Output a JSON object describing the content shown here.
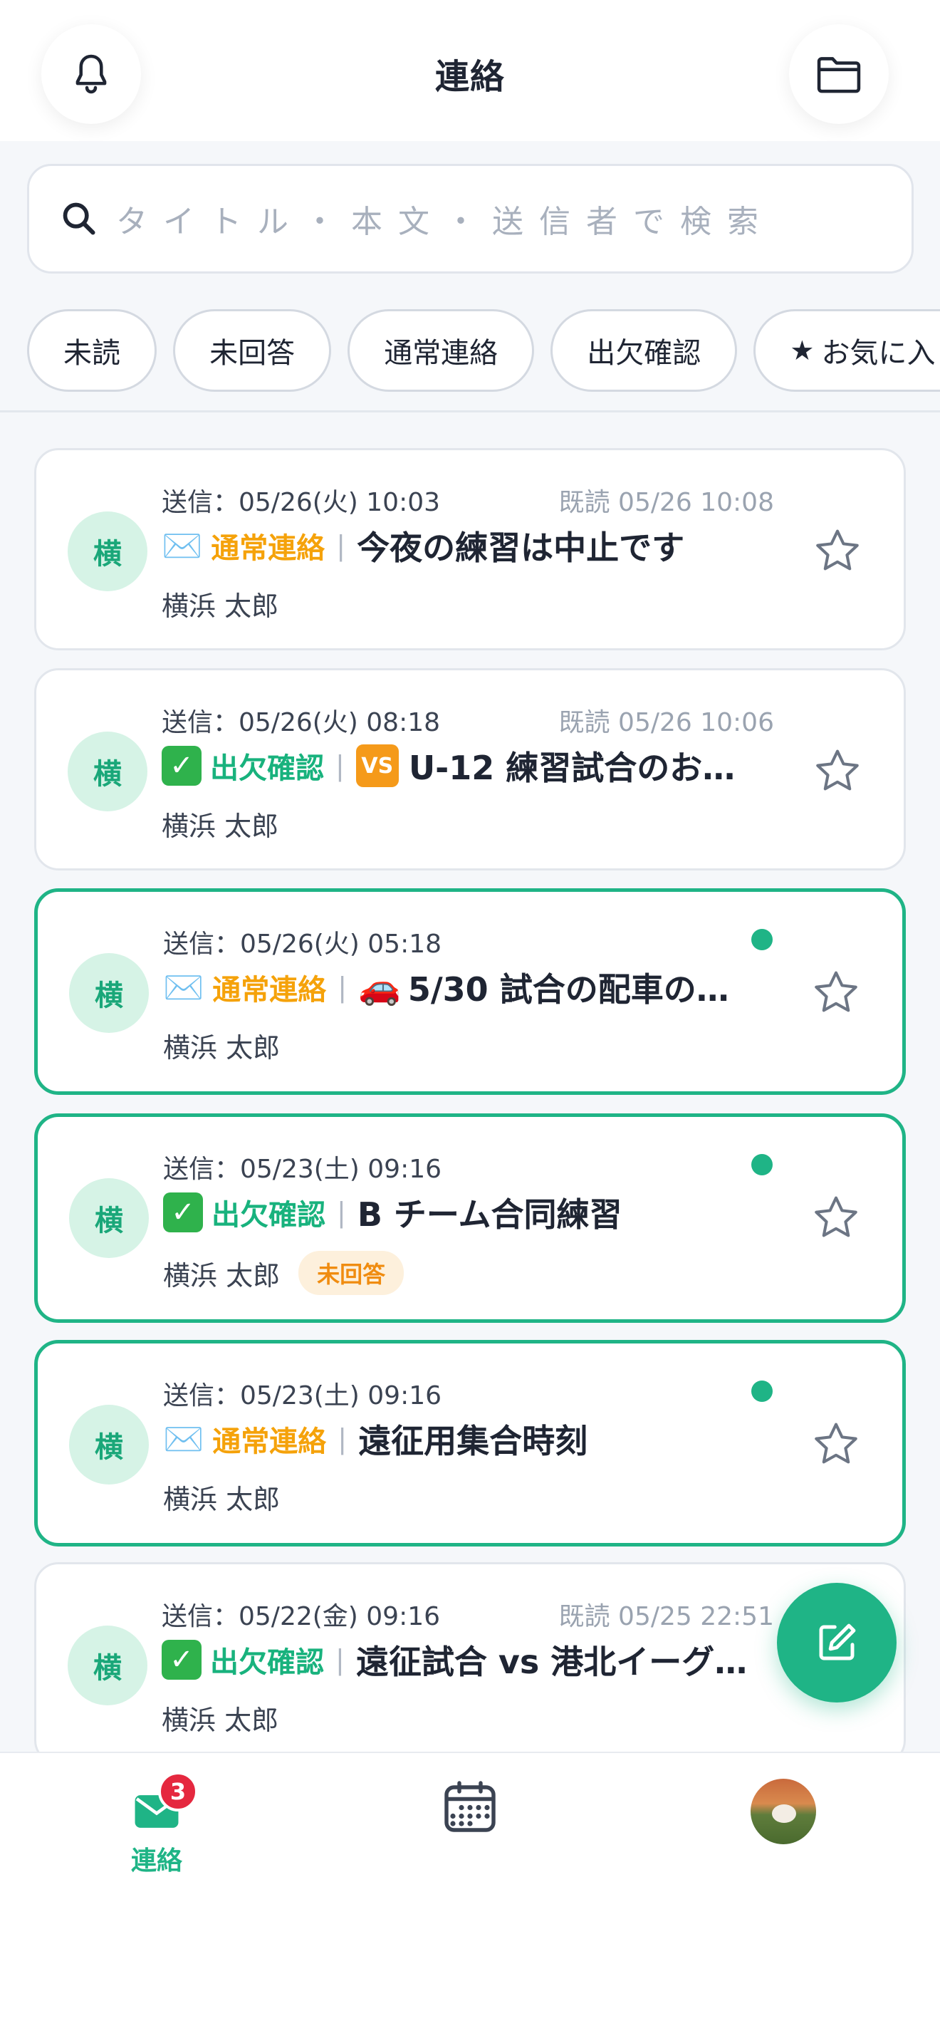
{
  "header": {
    "title": "連絡",
    "bell_icon": "bell-icon",
    "folder_icon": "folder-icon"
  },
  "search": {
    "placeholder": "タイトル・本文・送信者で検索",
    "icon": "search-icon"
  },
  "filters": [
    {
      "label": "未読"
    },
    {
      "label": "未回答"
    },
    {
      "label": "通常連絡"
    },
    {
      "label": "出欠確認"
    },
    {
      "label": "お気に入り",
      "icon": "★"
    }
  ],
  "messages": [
    {
      "avatar": "横",
      "sent": "送信：05/26(火) 10:03",
      "read": "既読 05/26 10:08",
      "category_icon": "✉️",
      "category": "通常連絡",
      "separator": "|",
      "title": "今夜の練習は中止です",
      "sender": "横浜 太郎",
      "unread": false
    },
    {
      "avatar": "横",
      "sent": "送信：05/26(火) 08:18",
      "read": "既読 05/26 10:06",
      "category_icon": "✓",
      "category": "出欠確認",
      "separator": "|",
      "title_badge": "VS",
      "title": "U-12 練習試合のお…",
      "sender": "横浜 太郎",
      "unread": false
    },
    {
      "avatar": "横",
      "sent": "送信：05/26(火) 05:18",
      "category_icon": "✉️",
      "category": "通常連絡",
      "separator": "|",
      "title_emoji": "🚗",
      "title": "5/30 試合の配車の…",
      "sender": "横浜 太郎",
      "unread": true
    },
    {
      "avatar": "横",
      "sent": "送信：05/23(土) 09:16",
      "category_icon": "✓",
      "category": "出欠確認",
      "separator": "|",
      "title": "B チーム合同練習",
      "sender": "横浜 太郎",
      "status_badge": "未回答",
      "unread": true
    },
    {
      "avatar": "横",
      "sent": "送信：05/23(土) 09:16",
      "category_icon": "✉️",
      "category": "通常連絡",
      "separator": "|",
      "title": "遠征用集合時刻",
      "sender": "横浜 太郎",
      "unread": true
    },
    {
      "avatar": "横",
      "sent": "送信：05/22(金) 09:16",
      "read": "既読 05/25 22:51",
      "category_icon": "✓",
      "category": "出欠確認",
      "separator": "|",
      "title": "遠征試合 vs 港北イーグ…",
      "sender": "横浜 太郎",
      "unread": false
    }
  ],
  "fab": {
    "icon": "compose-icon"
  },
  "bottom_nav": {
    "contact_label": "連絡",
    "contact_badge": "3",
    "calendar_icon": "calendar-icon",
    "profile_icon": "profile-avatar"
  },
  "colors": {
    "accent": "#1fb486",
    "normal_category": "#f5a20a",
    "attendance_category": "#18b27d",
    "badge_red": "#e5283f"
  }
}
